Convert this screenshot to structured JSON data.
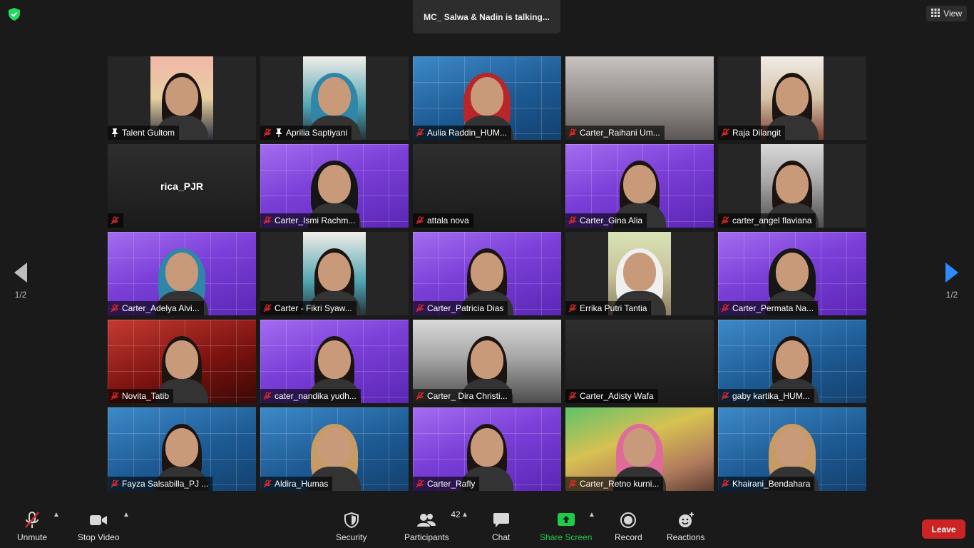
{
  "header": {
    "talking_text": "MC_ Salwa & Nadin is talking...",
    "view_label": "View"
  },
  "pagination": {
    "left_page": "1/2",
    "right_page": "1/2"
  },
  "participants": [
    {
      "name": "Talent Gultom",
      "muted": false,
      "pinned": true,
      "bg": "bg-room1",
      "portrait": true,
      "person": "hair"
    },
    {
      "name": "Aprilia Saptiyani",
      "muted": true,
      "pinned": true,
      "bg": "bg-room2",
      "portrait": true,
      "person": "hijab-blue"
    },
    {
      "name": "Aulia Raddin_HUM...",
      "muted": true,
      "pinned": false,
      "bg": "bg-blue",
      "portrait": false,
      "person": "hijab-red"
    },
    {
      "name": "Carter_Raihani Um...",
      "muted": true,
      "pinned": false,
      "bg": "bg-grey",
      "portrait": false,
      "person": "none"
    },
    {
      "name": "Raja Dilangit",
      "muted": true,
      "pinned": false,
      "bg": "bg-room3",
      "portrait": true,
      "person": "hair"
    },
    {
      "name": "rica_PJR",
      "muted": true,
      "pinned": false,
      "bg": "bg-dark",
      "portrait": false,
      "person": "none",
      "center_name": true
    },
    {
      "name": "Carter_Ismi Rachm...",
      "muted": true,
      "pinned": false,
      "bg": "bg-purple",
      "portrait": false,
      "person": "hijab-black"
    },
    {
      "name": "attala nova",
      "muted": true,
      "pinned": false,
      "bg": "bg-dark",
      "portrait": false,
      "person": "none"
    },
    {
      "name": "Carter_Gina Alia",
      "muted": true,
      "pinned": false,
      "bg": "bg-purple",
      "portrait": false,
      "person": "hair"
    },
    {
      "name": "carter_angel flaviana",
      "muted": true,
      "pinned": false,
      "bg": "bg-car",
      "portrait": true,
      "person": "hair"
    },
    {
      "name": "Carter_Adelya Alvi...",
      "muted": true,
      "pinned": false,
      "bg": "bg-purple",
      "portrait": false,
      "person": "hijab-blue"
    },
    {
      "name": "Carter - Fikri Syaw...",
      "muted": true,
      "pinned": false,
      "bg": "bg-room2",
      "portrait": true,
      "person": "hair"
    },
    {
      "name": "Carter_Patricia Dias",
      "muted": true,
      "pinned": false,
      "bg": "bg-purple",
      "portrait": false,
      "person": "hair"
    },
    {
      "name": "Errika Putri Tantia",
      "muted": true,
      "pinned": false,
      "bg": "bg-green",
      "portrait": true,
      "person": "hijab-white"
    },
    {
      "name": "Carter_Permata Na...",
      "muted": true,
      "pinned": false,
      "bg": "bg-purple",
      "portrait": false,
      "person": "hijab-black"
    },
    {
      "name": "Novita_Tatib",
      "muted": true,
      "pinned": false,
      "bg": "bg-red",
      "portrait": false,
      "person": "hair"
    },
    {
      "name": "cater_nandika yudh...",
      "muted": true,
      "pinned": false,
      "bg": "bg-purple",
      "portrait": false,
      "person": "hair"
    },
    {
      "name": "Carter_ Dira Christi...",
      "muted": true,
      "pinned": false,
      "bg": "bg-car",
      "portrait": false,
      "person": "hair"
    },
    {
      "name": "Carter_Adisty Wafa",
      "muted": true,
      "pinned": false,
      "bg": "bg-dark",
      "portrait": false,
      "person": "none"
    },
    {
      "name": "gaby kartika_HUM...",
      "muted": true,
      "pinned": false,
      "bg": "bg-blue",
      "portrait": false,
      "person": "hair"
    },
    {
      "name": "Fayza Salsabilla_PJ ...",
      "muted": true,
      "pinned": false,
      "bg": "bg-blue",
      "portrait": false,
      "person": "hair"
    },
    {
      "name": "Aldira_Humas",
      "muted": true,
      "pinned": false,
      "bg": "bg-blue",
      "portrait": false,
      "person": "hijab-tan"
    },
    {
      "name": "Carter_Rafly",
      "muted": true,
      "pinned": false,
      "bg": "bg-purple",
      "portrait": false,
      "person": "hair"
    },
    {
      "name": "Carter_Retno kurni...",
      "muted": true,
      "pinned": false,
      "bg": "bg-colorful",
      "portrait": false,
      "person": "hijab-pink"
    },
    {
      "name": "Khairani_Bendahara",
      "muted": true,
      "pinned": false,
      "bg": "bg-blue",
      "portrait": false,
      "person": "hijab-tan"
    }
  ],
  "toolbar": {
    "unmute_label": "Unmute",
    "stop_video_label": "Stop Video",
    "security_label": "Security",
    "participants_label": "Participants",
    "participants_count": "42",
    "chat_label": "Chat",
    "share_screen_label": "Share Screen",
    "record_label": "Record",
    "reactions_label": "Reactions",
    "leave_label": "Leave"
  },
  "colors": {
    "background": "#1a1a1a",
    "tile_bg": "#262626",
    "muted_red": "#e02828",
    "share_green": "#1fcc4a",
    "leave_red": "#cc2424",
    "nav_arrow_blue": "#2d8cff",
    "shield_green": "#23d960"
  }
}
